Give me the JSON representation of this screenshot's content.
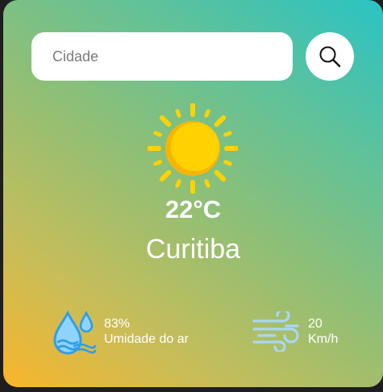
{
  "search": {
    "placeholder": "Cidade",
    "value": "",
    "button_icon": "search-icon"
  },
  "weather": {
    "icon": "sun-icon",
    "temperature": "22°C",
    "city": "Curitiba"
  },
  "details": {
    "humidity": {
      "icon": "humidity-drop-icon",
      "value": "83%",
      "label": "Umidade do ar"
    },
    "wind": {
      "icon": "wind-icon",
      "value": "20",
      "unit": "Km/h"
    }
  },
  "colors": {
    "gradient_start": "#f9b52a",
    "gradient_end": "#2ac3c4",
    "sun_core": "#ffd200",
    "sun_shade": "#f7b500",
    "drop_blue": "#33a6f5",
    "wind_blue": "#a9d8f5"
  }
}
